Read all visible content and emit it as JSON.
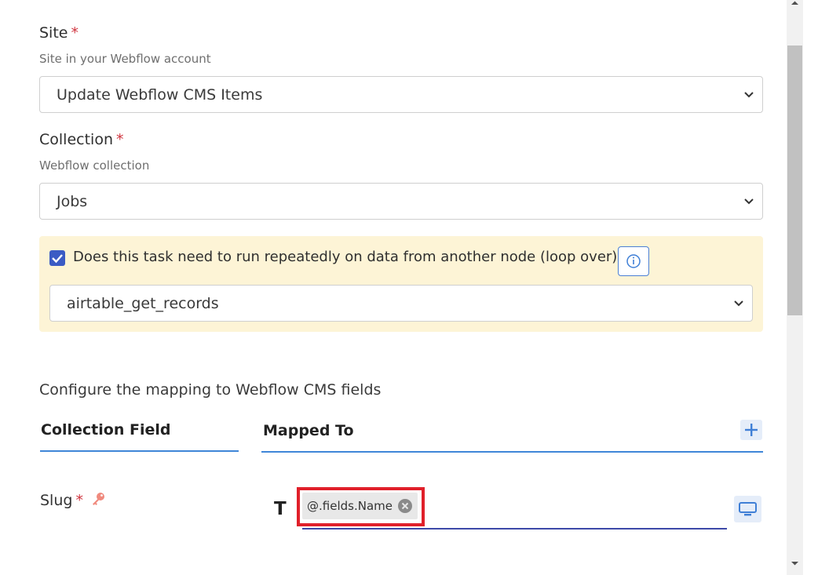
{
  "form": {
    "site": {
      "label": "Site",
      "required_mark": "*",
      "hint": "Site in your Webflow account",
      "selected": "Update Webflow CMS Items"
    },
    "collection": {
      "label": "Collection",
      "required_mark": "*",
      "hint": "Webflow collection",
      "selected": "Jobs"
    },
    "loop": {
      "checked": true,
      "question": "Does this task need to run repeatedly on data from another node (loop over)?",
      "selected_node": "airtable_get_records"
    }
  },
  "mapping": {
    "title": "Configure the mapping to Webflow CMS fields",
    "col_field": "Collection Field",
    "col_mapped": "Mapped To",
    "rows": [
      {
        "field": "Slug",
        "required_mark": "*",
        "type_glyph": "T",
        "chip": "@.fields.Name"
      }
    ]
  },
  "colors": {
    "accent_blue": "#3f86d8",
    "required_red": "#d0353f",
    "highlight_red": "#e0202a",
    "loop_bg": "#fdf4d6",
    "key_icon": "#f08a7e"
  },
  "icons": [
    "chevron-down-icon",
    "check-icon",
    "info-icon",
    "plus-icon",
    "key-icon",
    "text-type-icon",
    "close-circle-icon",
    "screen-icon"
  ]
}
